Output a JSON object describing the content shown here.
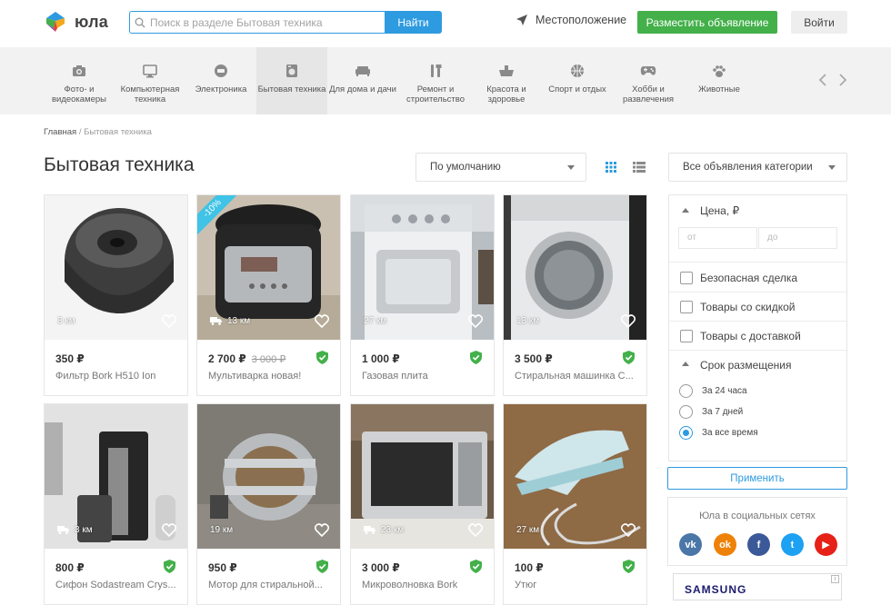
{
  "header": {
    "logo_text": "юла",
    "search_placeholder": "Поиск в разделе Бытовая техника",
    "search_button": "Найти",
    "location": "Местоположение",
    "post_button": "Разместить объявление",
    "login_button": "Войти"
  },
  "categories": [
    {
      "label": "Фото- и видеокамеры",
      "icon": "camera-icon"
    },
    {
      "label": "Компьютерная техника",
      "icon": "monitor-icon"
    },
    {
      "label": "Электроника",
      "icon": "electronics-icon"
    },
    {
      "label": "Бытовая техника",
      "icon": "appliance-icon",
      "active": true
    },
    {
      "label": "Для дома и дачи",
      "icon": "sofa-icon"
    },
    {
      "label": "Ремонт и строительство",
      "icon": "tools-icon"
    },
    {
      "label": "Красота и здоровье",
      "icon": "beauty-icon"
    },
    {
      "label": "Спорт и отдых",
      "icon": "ball-icon"
    },
    {
      "label": "Хобби и развлечения",
      "icon": "gamepad-icon"
    },
    {
      "label": "Животные",
      "icon": "paw-icon"
    }
  ],
  "breadcrumb": {
    "home": "Главная",
    "separator": "/",
    "current": "Бытовая техника"
  },
  "page_title": "Бытовая техника",
  "sort": {
    "selected": "По умолчанию"
  },
  "category_filter": {
    "selected": "Все объявления категории"
  },
  "listings": [
    {
      "distance": "3 км",
      "price": "350 ₽",
      "name": "Фильтр Bork H510 Ion",
      "verified": false,
      "delivery": false
    },
    {
      "distance": "13 км",
      "price": "2 700 ₽",
      "old_price": "3 000 ₽",
      "name": "Мультиварка новая!",
      "verified": true,
      "delivery": true,
      "discount": "-10%"
    },
    {
      "distance": "27 км",
      "price": "1 000 ₽",
      "name": "Газовая плита",
      "verified": true,
      "delivery": false
    },
    {
      "distance": "13 км",
      "price": "3 500 ₽",
      "name": "Стиральная машинка С...",
      "verified": true,
      "delivery": false
    },
    {
      "distance": "3 км",
      "price": "800 ₽",
      "name": "Сифон Sodastream Crys...",
      "verified": true,
      "delivery": true
    },
    {
      "distance": "19 км",
      "price": "950 ₽",
      "name": "Мотор для стиральной...",
      "verified": true,
      "delivery": false
    },
    {
      "distance": "23 км",
      "price": "3 000 ₽",
      "name": "Микроволновка Bork",
      "verified": true,
      "delivery": true
    },
    {
      "distance": "27 км",
      "price": "100 ₽",
      "name": "Утюг",
      "verified": true,
      "delivery": false
    }
  ],
  "filters": {
    "price_label": "Цена, ₽",
    "price_from_placeholder": "от",
    "price_to_placeholder": "до",
    "checkboxes": [
      "Безопасная сделка",
      "Товары со скидкой",
      "Товары с доставкой"
    ],
    "period_label": "Срок размещения",
    "period_options": [
      "За 24 часа",
      "За 7 дней",
      "За все время"
    ],
    "period_selected": "За все время",
    "apply_button": "Применить"
  },
  "social": {
    "title": "Юла в социальных сетях",
    "networks": [
      {
        "name": "vk-icon",
        "glyph": "vk",
        "color": "#4a76a8"
      },
      {
        "name": "odnoklassniki-icon",
        "glyph": "ok",
        "color": "#ee8208"
      },
      {
        "name": "facebook-icon",
        "glyph": "f",
        "color": "#3b5998"
      },
      {
        "name": "twitter-icon",
        "glyph": "t",
        "color": "#1da1f2"
      },
      {
        "name": "youtube-icon",
        "glyph": "▶",
        "color": "#e62117"
      }
    ]
  },
  "ad": {
    "brand": "SAMSUNG"
  },
  "colors": {
    "accent": "#2e9be0",
    "green": "#43b04a",
    "discount": "#3fc3e6"
  }
}
